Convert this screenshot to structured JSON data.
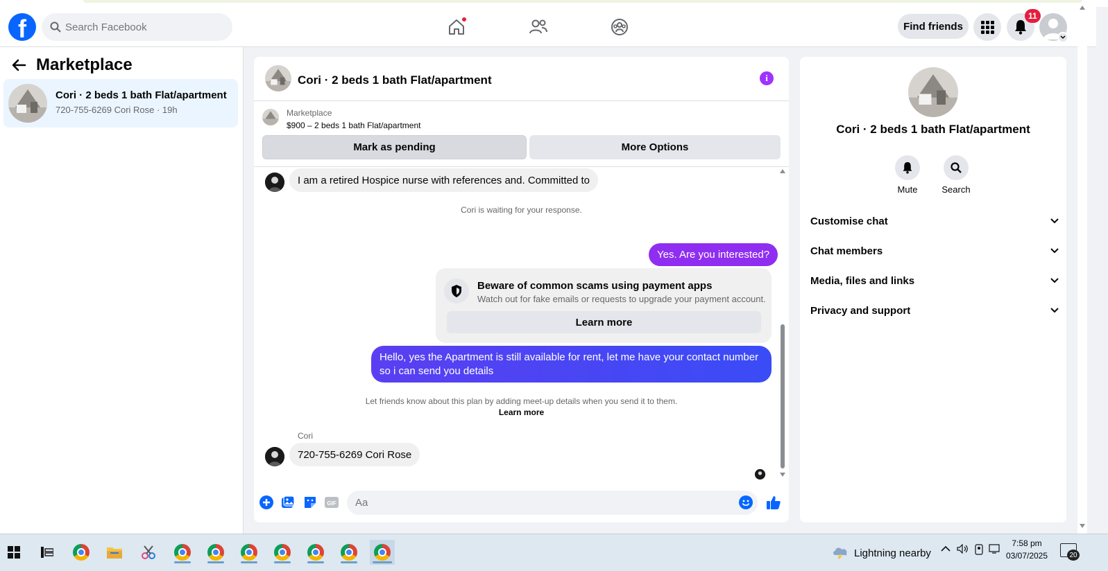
{
  "topnav": {
    "search_placeholder": "Search Facebook",
    "find_friends": "Find friends",
    "notification_count": "11",
    "icons": [
      "facebook-logo",
      "home-icon",
      "friends-icon",
      "groups-icon",
      "menu-grid-icon",
      "bell-icon",
      "avatar"
    ]
  },
  "sidebar": {
    "title": "Marketplace",
    "conversation": {
      "title": "Cori · 2 beds 1 bath Flat/apartment",
      "subtitle": "720-755-6269 Cori Rose · 19h"
    }
  },
  "chat": {
    "header_title": "Cori · 2 beds 1 bath Flat/apartment",
    "listing_source": "Marketplace",
    "listing_desc": "$900 – 2 beds 1 bath Flat/apartment",
    "mark_pending": "Mark as pending",
    "more_options": "More Options",
    "messages": {
      "incoming_1": "I am a retired Hospice nurse with references and. Committed  to",
      "waiting_note": "Cori is waiting for your response.",
      "outgoing_1": "Yes. Are you interested?",
      "outgoing_2": "Hello, yes the Apartment is still available for rent, let me have your contact number so i can send you details",
      "meetup_note": "Let friends know about this plan by adding meet-up details when you send it to them.",
      "meetup_link": "Learn more",
      "sender_name": "Cori",
      "incoming_2": "720-755-6269 Cori Rose"
    },
    "scam_warning": {
      "title": "Beware of common scams using payment apps",
      "desc": "Watch out for fake emails or requests to upgrade your payment account.",
      "button": "Learn more"
    },
    "composer_placeholder": "Aa",
    "colors": {
      "outgoing_gradient_top": "#9b2bef",
      "outgoing_gradient_bottom": "#3d4ef5",
      "accent": "#0866ff"
    }
  },
  "details": {
    "title": "Cori · 2 beds 1 bath Flat/apartment",
    "mute": "Mute",
    "search": "Search",
    "sections": [
      "Customise chat",
      "Chat members",
      "Media, files and links",
      "Privacy and support"
    ]
  },
  "taskbar": {
    "weather": "Lightning nearby",
    "time": "7:58 pm",
    "date": "03/07/2025",
    "notif_count": "20"
  }
}
